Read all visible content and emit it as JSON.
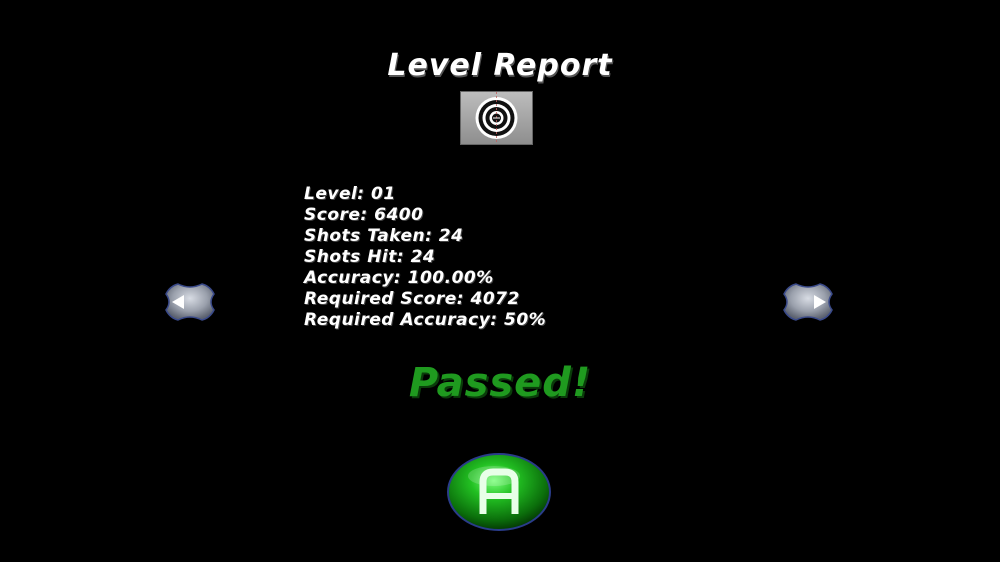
{
  "screen": {
    "title": "Level Report",
    "result": "Passed!"
  },
  "stats": [
    {
      "label": "Level: 01"
    },
    {
      "label": "Score: 6400"
    },
    {
      "label": "Shots Taken: 24"
    },
    {
      "label": "Shots Hit: 24"
    },
    {
      "label": "Accuracy: 100.00%"
    },
    {
      "label": "Required Score: 4072"
    },
    {
      "label": "Required Accuracy: 50%"
    }
  ],
  "buttons": {
    "prev_icon": "left-arrow-icon",
    "next_icon": "right-arrow-icon",
    "confirm_icon": "a-button-icon"
  },
  "colors": {
    "background": "#000000",
    "text": "#ffffff",
    "passed": "#1f9a1f",
    "a_button": "#1faa1f"
  }
}
